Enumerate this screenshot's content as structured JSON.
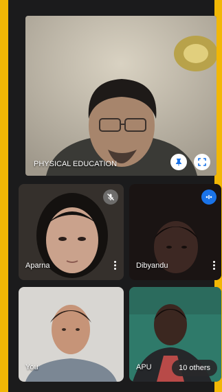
{
  "tiles": {
    "main": {
      "name": "PHYSICAL EDUCATION"
    },
    "aparna": {
      "name": "Aparna"
    },
    "dibyandu": {
      "name": "Dibyandu"
    },
    "you": {
      "name": "You"
    },
    "apu": {
      "name": "APU"
    }
  },
  "overflow": {
    "label": "10 others"
  },
  "icons": {
    "pin": "pin-icon",
    "fullscreen": "fullscreen-icon",
    "mic_off": "mic-off-icon",
    "speaking": "speaking-indicator-icon",
    "more": "more-options-icon"
  },
  "colors": {
    "border": "#f2b705",
    "accent": "#1a73e8",
    "panel": "#1b1b1c"
  }
}
